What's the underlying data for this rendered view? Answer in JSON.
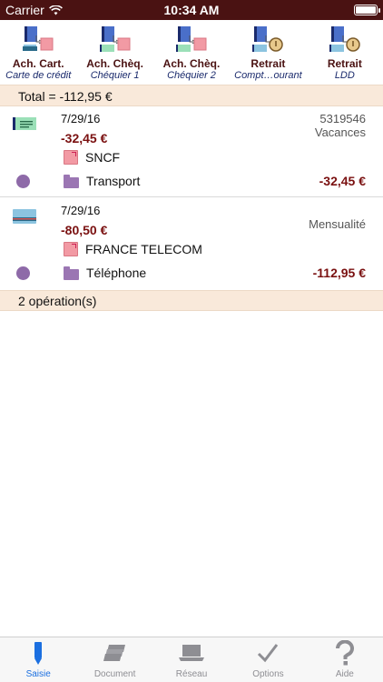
{
  "status_bar": {
    "carrier": "Carrier",
    "time": "10:34 AM"
  },
  "toolbar": {
    "items": [
      {
        "label": "Ach. Cart.",
        "sublabel": "Carte de crédit"
      },
      {
        "label": "Ach. Chèq.",
        "sublabel": "Chéquier 1"
      },
      {
        "label": "Ach. Chèq.",
        "sublabel": "Chéquier 2"
      },
      {
        "label": "Retrait",
        "sublabel": "Compt…ourant"
      },
      {
        "label": "Retrait",
        "sublabel": "LDD"
      }
    ]
  },
  "total": "Total = -112,95 €",
  "operations": [
    {
      "date": "7/29/16",
      "amount": "-32,45 €",
      "reference": "5319546",
      "note": "Vacances",
      "payee": "SNCF",
      "category": "Transport",
      "balance": "-32,45 €",
      "payment_icon": "cheque-icon"
    },
    {
      "date": "7/29/16",
      "amount": "-80,50 €",
      "reference": "",
      "note": "Mensualité",
      "payee": "FRANCE TELECOM",
      "category": "Téléphone",
      "balance": "-112,95 €",
      "payment_icon": "card-icon"
    }
  ],
  "count": "2 opération(s)",
  "tabs": [
    {
      "label": "Saisie",
      "icon": "pen-icon",
      "active": true
    },
    {
      "label": "Document",
      "icon": "documents-icon",
      "active": false
    },
    {
      "label": "Réseau",
      "icon": "laptop-icon",
      "active": false
    },
    {
      "label": "Options",
      "icon": "checkmark-icon",
      "active": false
    },
    {
      "label": "Aide",
      "icon": "question-icon",
      "active": false
    }
  ],
  "colors": {
    "status_bar": "#4a1212",
    "accent_dark_red": "#7a1010",
    "section_bg": "#f9e9da",
    "active_tab": "#1b6fe0",
    "category_dot": "#8e6aa8"
  }
}
